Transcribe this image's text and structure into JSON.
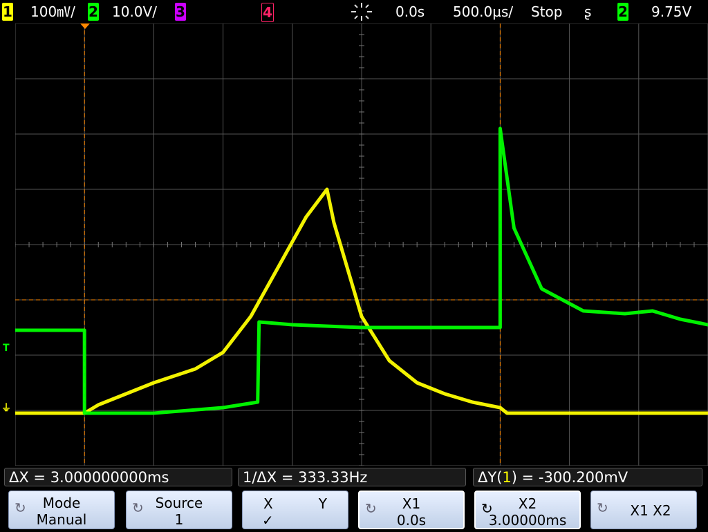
{
  "topbar": {
    "ch1_num": "1",
    "ch1_scale": "100㎷/",
    "ch2_num": "2",
    "ch2_scale": "10.0V/",
    "ch3_num": "3",
    "ch4_num": "4",
    "trigger_delay": "0.0s",
    "timebase": "500.0µs/",
    "run_state": "Stop",
    "trigger_slope_glyph": "ʂ",
    "trigger_src": "2",
    "trigger_level": "9.75V"
  },
  "markers": {
    "trig_level": "T",
    "ground": "⏚"
  },
  "measurements": {
    "delta_x": "ΔX = 3.000000000ms",
    "inv_delta_x": "1/ΔX = 333.33Hz",
    "delta_y_prefix": "ΔY(",
    "delta_y_ch": "1",
    "delta_y_suffix": ") = -300.200mV"
  },
  "softkeys": {
    "mode_label": "Mode",
    "mode_value": "Manual",
    "source_label": "Source",
    "source_value": "1",
    "x_label": "X",
    "y_label": "Y",
    "x_checked": "✓",
    "x1_label": "X1",
    "x1_value": "0.0s",
    "x2_label": "X2",
    "x2_value": "3.00000ms",
    "x1x2_label": "X1 X2"
  },
  "colors": {
    "ch1": "#ffff00",
    "ch2": "#00ff00",
    "cursor": "#ff8800",
    "grid": "#555555"
  },
  "chart_data": {
    "type": "line",
    "x_units": "ms",
    "xlim": [
      -0.5,
      4.5
    ],
    "series": [
      {
        "channel": "1",
        "color": "#ffff00",
        "volts_per_div": 0.1,
        "x": [
          -0.5,
          0.0,
          0.1,
          0.3,
          0.5,
          0.8,
          1.0,
          1.2,
          1.4,
          1.6,
          1.75,
          1.8,
          2.0,
          2.2,
          2.4,
          2.6,
          2.8,
          3.0,
          3.05,
          3.1,
          3.5,
          4.0,
          4.5
        ],
        "y": [
          -3.05,
          -3.05,
          -2.9,
          -2.7,
          -2.5,
          -2.25,
          -1.95,
          -1.3,
          -0.4,
          0.5,
          1.0,
          0.4,
          -1.3,
          -2.1,
          -2.5,
          -2.7,
          -2.85,
          -2.95,
          -3.05,
          -3.05,
          -3.05,
          -3.05,
          -3.05
        ]
      },
      {
        "channel": "2",
        "color": "#00ff00",
        "volts_per_div": 10.0,
        "x": [
          -0.5,
          0.0,
          0.0,
          0.5,
          1.0,
          1.25,
          1.26,
          1.5,
          2.0,
          2.5,
          3.0,
          3.0,
          3.1,
          3.3,
          3.6,
          3.9,
          4.1,
          4.3,
          4.5
        ],
        "y": [
          -1.55,
          -1.55,
          -3.05,
          -3.05,
          -2.95,
          -2.85,
          -1.4,
          -1.45,
          -1.5,
          -1.5,
          -1.5,
          2.1,
          0.3,
          -0.8,
          -1.2,
          -1.25,
          -1.2,
          -1.35,
          -1.45
        ]
      }
    ],
    "cursors": {
      "x1_ms": 0.0,
      "x2_ms": 3.0,
      "y_div": -1.0
    }
  }
}
